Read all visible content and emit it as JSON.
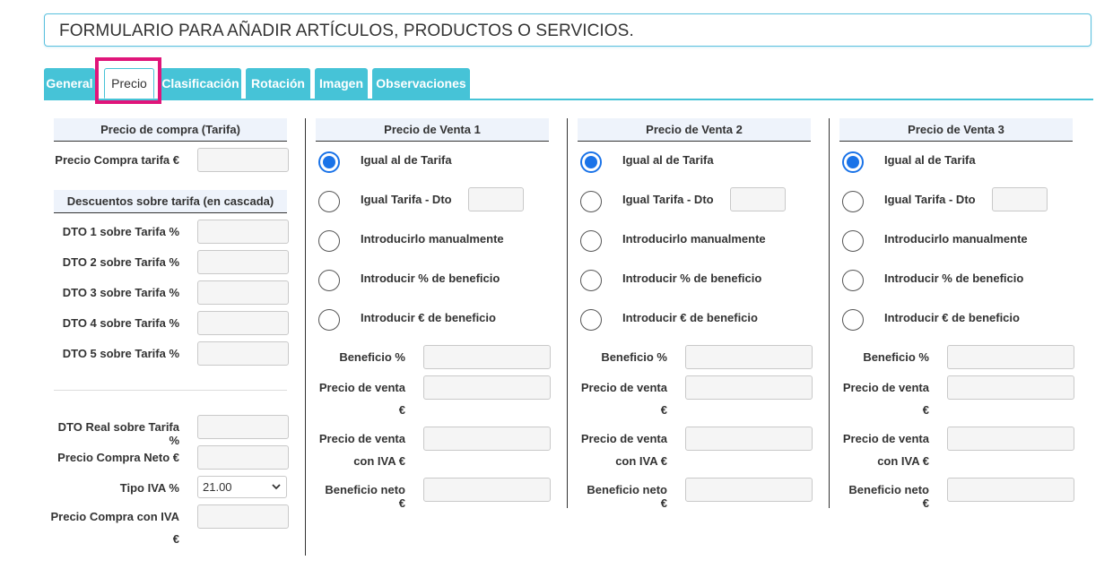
{
  "form_title": "FORMULARIO PARA AÑADIR ARTÍCULOS, PRODUCTOS O SERVICIOS.",
  "tabs": [
    {
      "label": "General"
    },
    {
      "label": "Precio"
    },
    {
      "label": "Clasificación"
    },
    {
      "label": "Rotación"
    },
    {
      "label": "Imagen"
    },
    {
      "label": "Observaciones"
    }
  ],
  "active_tab": "Precio",
  "compra": {
    "header": "Precio de compra (Tarifa)",
    "precio_tarifa_label": "Precio Compra tarifa €",
    "descuentos_header": "Descuentos sobre tarifa (en cascada)",
    "dto1": "DTO 1 sobre Tarifa %",
    "dto2": "DTO 2 sobre Tarifa %",
    "dto3": "DTO 3 sobre Tarifa %",
    "dto4": "DTO 4 sobre Tarifa %",
    "dto5": "DTO 5 sobre Tarifa %",
    "dto_real": "DTO Real sobre Tarifa %",
    "precio_neto": "Precio Compra Neto €",
    "tipo_iva": "Tipo IVA %",
    "tipo_iva_value": "21.00",
    "precio_con_iva_l1": "Precio Compra con IVA",
    "precio_con_iva_l2": "€"
  },
  "venta": [
    {
      "header": "Precio de Venta 1"
    },
    {
      "header": "Precio de Venta 2"
    },
    {
      "header": "Precio de Venta 3"
    }
  ],
  "venta_options": {
    "igual_tarifa": "Igual al de Tarifa",
    "igual_dto": "Igual Tarifa - Dto",
    "manual": "Introducirlo manualmente",
    "pct_beneficio": "Introducir % de beneficio",
    "eur_beneficio": "Introducir € de beneficio"
  },
  "venta_fields": {
    "beneficio_pct": "Beneficio %",
    "precio_venta_l1": "Precio de venta",
    "precio_venta_l2": "€",
    "precio_iva_l1": "Precio de venta",
    "precio_iva_l2": "con IVA €",
    "beneficio_neto": "Beneficio neto €"
  },
  "colors": {
    "tab_bg": "#46c3d7",
    "radio_checked": "#1a73e8",
    "highlight": "#e0157a"
  }
}
